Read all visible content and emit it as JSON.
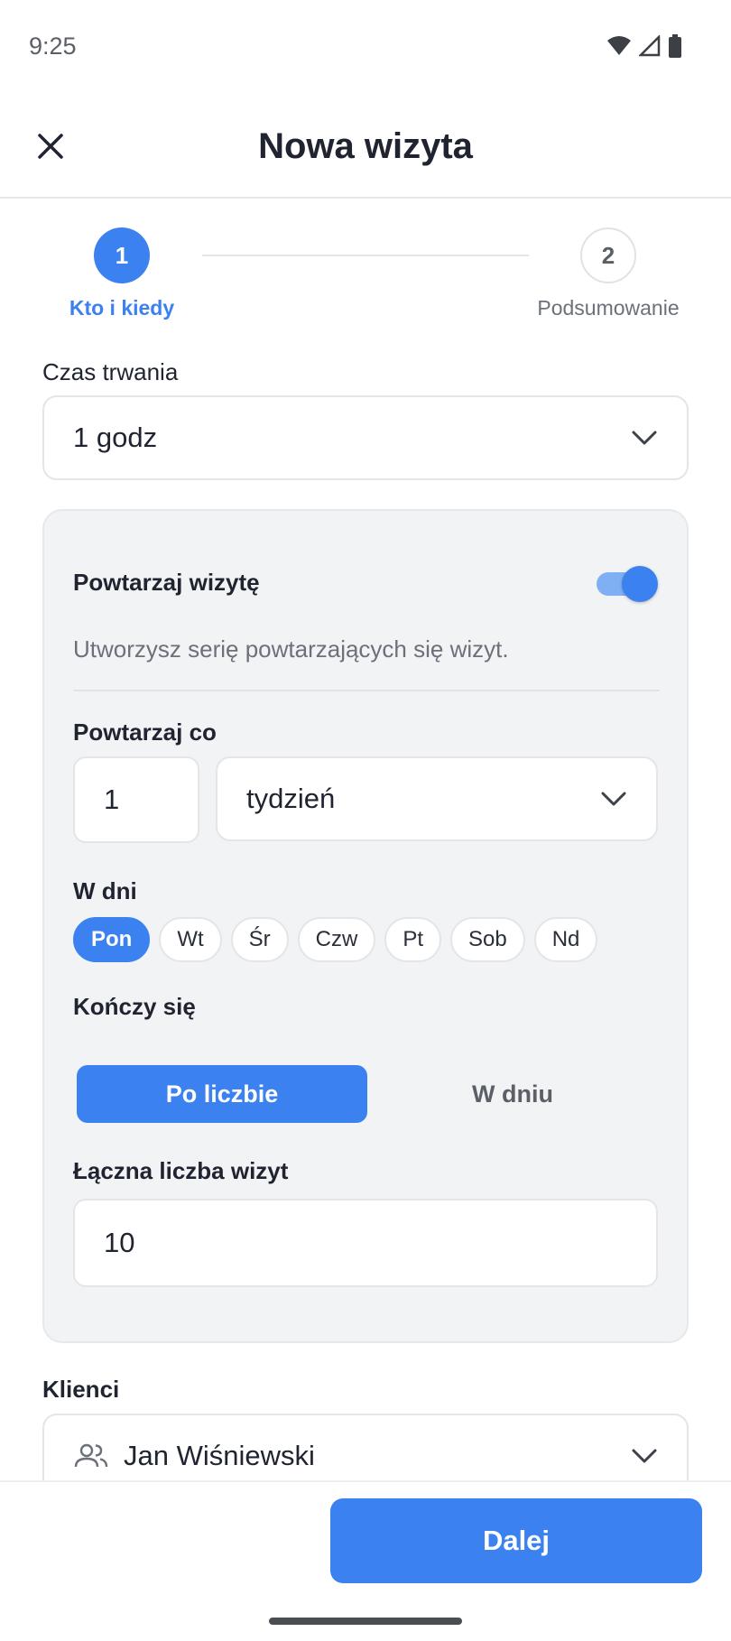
{
  "status_bar": {
    "time": "9:25"
  },
  "header": {
    "title": "Nowa wizyta"
  },
  "stepper": {
    "steps": [
      {
        "number": "1",
        "label": "Kto i kiedy"
      },
      {
        "number": "2",
        "label": "Podsumowanie"
      }
    ]
  },
  "duration": {
    "label": "Czas trwania",
    "value": "1 godz"
  },
  "repeat": {
    "title": "Powtarzaj wizytę",
    "enabled": true,
    "helper": "Utworzysz serię powtarzających się wizyt.",
    "interval_label": "Powtarzaj co",
    "interval_value": "1",
    "interval_unit": "tydzień",
    "days_label": "W dni",
    "days": [
      "Pon",
      "Wt",
      "Śr",
      "Czw",
      "Pt",
      "Sob",
      "Nd"
    ],
    "selected_days": [
      "Pon"
    ],
    "ends_label": "Kończy się",
    "ends_options": [
      "Po liczbie",
      "W dniu"
    ],
    "ends_selected": "Po liczbie",
    "count_label": "Łączna liczba wizyt",
    "count_value": "10"
  },
  "clients": {
    "label": "Klienci",
    "value": "Jan Wiśniewski"
  },
  "footer": {
    "next_label": "Dalej"
  },
  "colors": {
    "accent": "#3b82f0",
    "card_bg": "#f2f3f5",
    "border": "#e3e5e9"
  }
}
